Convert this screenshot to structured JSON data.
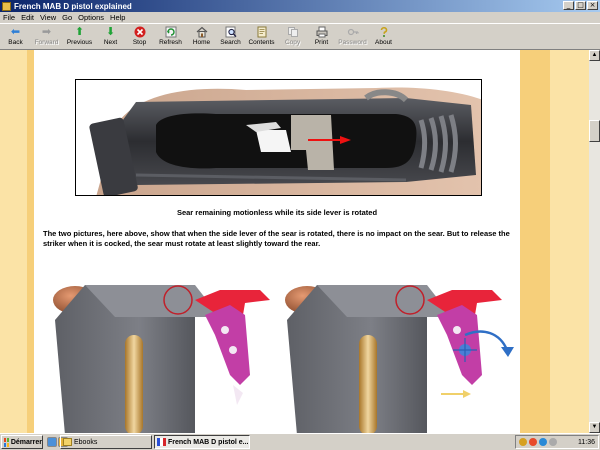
{
  "window": {
    "title": "French MAB D pistol explained",
    "buttons": [
      "_",
      "□",
      "×"
    ]
  },
  "menu": [
    "File",
    "Edit",
    "View",
    "Go",
    "Options",
    "Help"
  ],
  "toolbar": {
    "back": {
      "label": "Back",
      "icon": "arrow-left-icon"
    },
    "forward": {
      "label": "Forward",
      "icon": "arrow-right-icon"
    },
    "previous": {
      "label": "Previous",
      "icon": "arrow-up-icon"
    },
    "next": {
      "label": "Next",
      "icon": "arrow-down-icon"
    },
    "stop": {
      "label": "Stop",
      "icon": "stop-icon"
    },
    "refresh": {
      "label": "Refresh",
      "icon": "refresh-icon"
    },
    "home": {
      "label": "Home",
      "icon": "home-icon"
    },
    "search": {
      "label": "Search",
      "icon": "search-icon"
    },
    "contents": {
      "label": "Contents",
      "icon": "contents-icon"
    },
    "copy": {
      "label": "Copy",
      "icon": "copy-icon"
    },
    "print": {
      "label": "Print",
      "icon": "print-icon"
    },
    "password": {
      "label": "Password",
      "icon": "key-icon"
    },
    "about": {
      "label": "About",
      "icon": "about-icon"
    }
  },
  "content": {
    "caption": "Sear remaining motionless while its side lever is rotated",
    "paragraph": "The two pictures, here above, show that when the side lever of the sear is rotated, there is no impact on the sear. But to release the striker when it is cocked, the sear must rotate at least slightly toward the rear."
  },
  "taskbar": {
    "start_label": "Démarrer",
    "tasks": [
      {
        "label": "Ebooks"
      },
      {
        "label": "French MAB D pistol e..."
      }
    ],
    "clock": "11:36"
  },
  "colors": {
    "title_bar": "#0a246a",
    "page_side": "#fbe3a6",
    "sear_red": "#e8243a",
    "lever_magenta": "#c23ea6"
  }
}
